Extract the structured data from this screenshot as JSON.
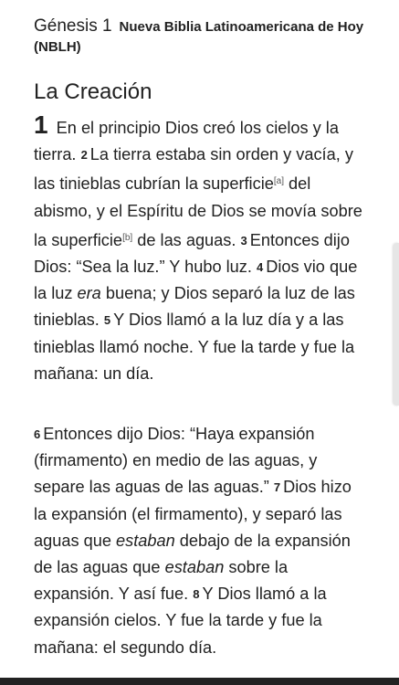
{
  "header": {
    "book_ref": "Génesis 1",
    "version": "Nueva Biblia Latinoamericana de Hoy (NBLH)"
  },
  "section_title": "La Creación",
  "chapter_number": "1",
  "paragraph1": {
    "v1_text": "En el principio Dios creó los cielos y la tierra.",
    "v2_num": "2",
    "v2_text_a": "La tierra estaba sin orden y vacía, y las tinieblas cubrían la superficie",
    "fn_a": "[a]",
    "v2_text_b": " del abismo, y el Espíritu de Dios se movía sobre la superficie",
    "fn_b": "[b]",
    "v2_text_c": " de las aguas.",
    "v3_num": "3",
    "v3_text": "Entonces dijo Dios: “Sea la luz.” Y hubo luz.",
    "v4_num": "4",
    "v4_text_a": "Dios vio que la luz ",
    "v4_italic": "era",
    "v4_text_b": " buena; y Dios separó la luz de las tinieblas.",
    "v5_num": "5",
    "v5_text": "Y Dios llamó a la luz día y a las tinieblas llamó noche. Y fue la tarde y fue la mañana: un día."
  },
  "paragraph2": {
    "v6_num": "6",
    "v6_text": "Entonces dijo Dios: “Haya expansión (firmamento) en medio de las aguas, y separe las aguas de las aguas.”",
    "v7_num": "7",
    "v7_text_a": "Dios hizo la expansión (el firmamento), y separó las aguas que ",
    "v7_italic_a": "estaban",
    "v7_text_b": " debajo de la expansión de las aguas que ",
    "v7_italic_b": "estaban",
    "v7_text_c": " sobre la expansión. Y así fue.",
    "v8_num": "8",
    "v8_text": "Y Dios llamó a la expansión cielos. Y fue la tarde y fue la mañana: el segundo día."
  }
}
